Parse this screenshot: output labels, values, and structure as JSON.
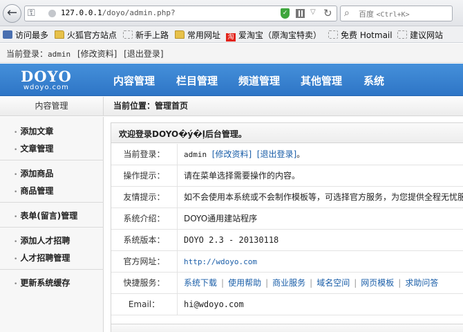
{
  "browser": {
    "url_host": "127.0.0.1",
    "url_path": "/doyo/admin.php?",
    "search_label": "百度",
    "search_shortcut": "<Ctrl+K>"
  },
  "bookmarks": [
    {
      "label": "访问最多",
      "icon": "bookmark-icon"
    },
    {
      "label": "火狐官方站点",
      "icon": "folder-icon"
    },
    {
      "label": "新手上路",
      "icon": "dashed-page-icon"
    },
    {
      "label": "常用网址",
      "icon": "folder-icon"
    },
    {
      "label": "爱淘宝（原淘宝特卖）",
      "icon": "taobao-icon"
    },
    {
      "label": "免费 Hotmail",
      "icon": "dashed-page-icon"
    },
    {
      "label": "建议网站",
      "icon": "dashed-page-icon"
    }
  ],
  "login_strip": {
    "prefix": "当前登录：",
    "user": "admin",
    "profile_link": "[修改资料]",
    "logout_link": "[退出登录]"
  },
  "header": {
    "logo_big": "DOYO",
    "logo_small": "wdoyo.com",
    "nav": [
      "内容管理",
      "栏目管理",
      "频道管理",
      "其他管理",
      "系统"
    ]
  },
  "breadcrumb": {
    "sidebar_title": "内容管理",
    "location": "当前位置：管理首页"
  },
  "sidebar": {
    "items": [
      "添加文章",
      "文章管理",
      "添加商品",
      "商品管理",
      "表单(留言)管理",
      "添加人才招聘",
      "人才招聘管理",
      "更新系统缓存"
    ]
  },
  "main": {
    "welcome": "欢迎登录DOYO�ý�ļ后台管理。",
    "rows": {
      "login_label": "当前登录：",
      "login_user": "admin",
      "login_profile": "[修改资料]",
      "login_logout": "[退出登录]",
      "login_suffix": "。",
      "tip_label": "操作提示：",
      "tip_value": "请在菜单选择需要操作的内容。",
      "friendly_label": "友情提示：",
      "friendly_value": "如不会使用本系统或不会制作模板等，可选择官方服务，为您提供全程无忧服务",
      "intro_label": "系统介绍：",
      "intro_value": "DOYO通用建站程序",
      "version_label": "系统版本：",
      "version_value": "DOYO 2.3 - 20130118",
      "site_label": "官方网址：",
      "site_value": "http://wdoyo.com",
      "services_label": "快捷服务：",
      "services": [
        "系统下载",
        "使用帮助",
        "商业服务",
        "域名空间",
        "网页模板",
        "求助问答"
      ],
      "email_label": "Email：",
      "email_value": "hi@wdoyo.com"
    }
  }
}
